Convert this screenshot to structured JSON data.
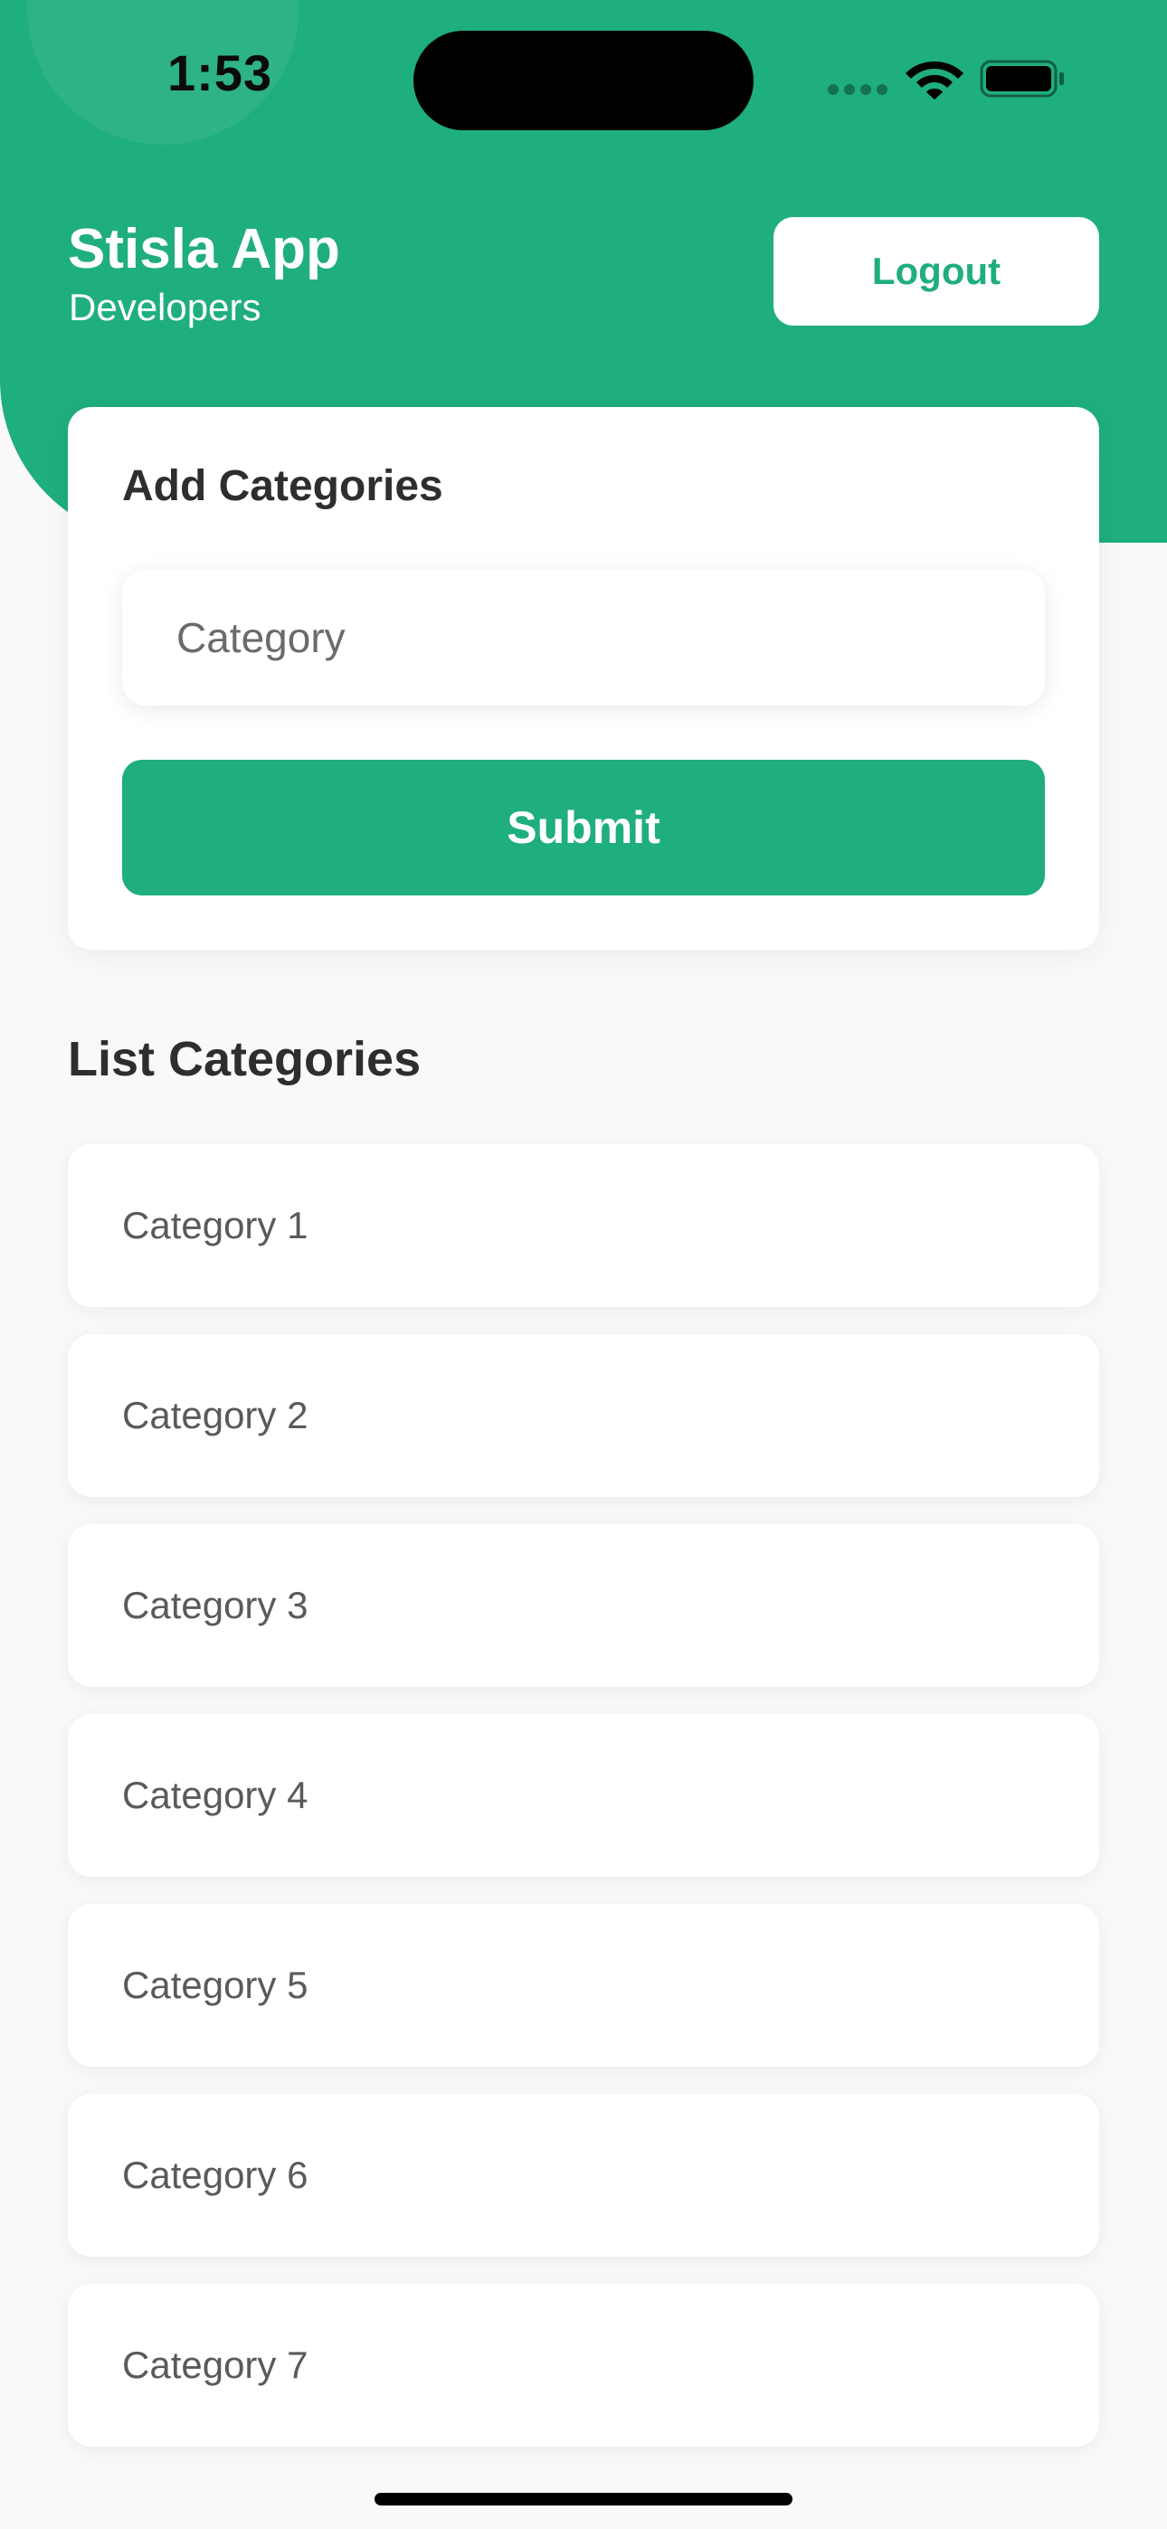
{
  "status_bar": {
    "time": "1:53"
  },
  "header": {
    "title": "Stisla App",
    "subtitle": "Developers",
    "logout_label": "Logout"
  },
  "add_card": {
    "title": "Add Categories",
    "input_placeholder": "Category",
    "input_value": "",
    "submit_label": "Submit"
  },
  "list": {
    "title": "List Categories",
    "items": [
      {
        "label": "Category 1"
      },
      {
        "label": "Category 2"
      },
      {
        "label": "Category 3"
      },
      {
        "label": "Category 4"
      },
      {
        "label": "Category 5"
      },
      {
        "label": "Category 6"
      },
      {
        "label": "Category 7"
      }
    ]
  },
  "icons": {
    "signal": "cellular-signal-icon",
    "wifi": "wifi-icon",
    "battery": "battery-icon"
  },
  "colors": {
    "brand": "#1fae7e",
    "background": "#f9f9f9",
    "card": "#ffffff",
    "heading_text": "#2e2e2e",
    "item_text": "#5a5a5a"
  }
}
